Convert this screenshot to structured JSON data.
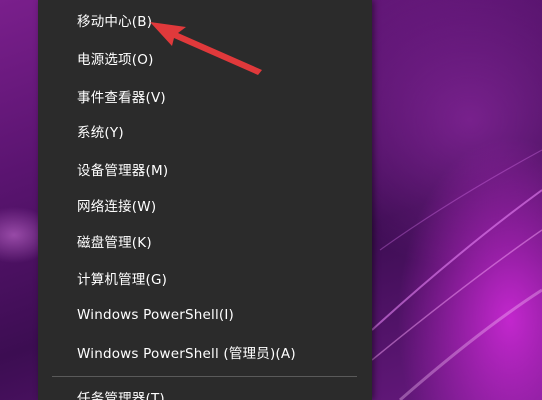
{
  "menu": {
    "items": [
      {
        "id": "mobility-center",
        "label": "移动中心(B)"
      },
      {
        "id": "power-options",
        "label": "电源选项(O)"
      },
      {
        "id": "event-viewer",
        "label": "事件查看器(V)"
      },
      {
        "id": "system",
        "label": "系统(Y)"
      },
      {
        "id": "device-manager",
        "label": "设备管理器(M)"
      },
      {
        "id": "network-connections",
        "label": "网络连接(W)"
      },
      {
        "id": "disk-management",
        "label": "磁盘管理(K)"
      },
      {
        "id": "computer-management",
        "label": "计算机管理(G)"
      },
      {
        "id": "windows-powershell",
        "label": "Windows PowerShell(I)"
      },
      {
        "id": "windows-powershell-admin",
        "label": "Windows PowerShell (管理员)(A)"
      },
      {
        "id": "task-manager",
        "label": "任务管理器(T)"
      }
    ]
  },
  "colors": {
    "menu_background": "#2b2b2b",
    "menu_text": "#ffffff",
    "arrow": "#e0393b",
    "desktop_accent": "#b02cc0"
  }
}
